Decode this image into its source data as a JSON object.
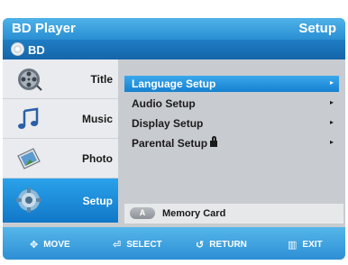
{
  "header": {
    "title": "BD Player",
    "section": "Setup"
  },
  "subheader": {
    "disc_label": "BD"
  },
  "nav": {
    "items": [
      {
        "label": "Title",
        "icon": "film-reel-icon"
      },
      {
        "label": "Music",
        "icon": "music-note-icon"
      },
      {
        "label": "Photo",
        "icon": "photo-icon"
      },
      {
        "label": "Setup",
        "icon": "gear-icon",
        "active": true
      }
    ]
  },
  "menu": {
    "items": [
      {
        "label": "Language Setup",
        "arrow": "▸",
        "selected": true
      },
      {
        "label": "Audio Setup",
        "arrow": "▸"
      },
      {
        "label": "Display Setup",
        "arrow": "▸"
      },
      {
        "label": "Parental Setup",
        "arrow": "▸",
        "icon": "lock-icon"
      }
    ]
  },
  "memory": {
    "key_label": "A",
    "label": "Memory Card"
  },
  "footer": {
    "hints": [
      {
        "icon": "✥",
        "label": "MOVE"
      },
      {
        "icon": "⏎",
        "label": "SELECT"
      },
      {
        "icon": "↺",
        "label": "RETURN"
      },
      {
        "icon": "▥",
        "label": "EXIT"
      }
    ]
  },
  "colors": {
    "accent": "#2a8fd3",
    "panel": "#c8cbcf",
    "highlight": "#1680d0"
  }
}
